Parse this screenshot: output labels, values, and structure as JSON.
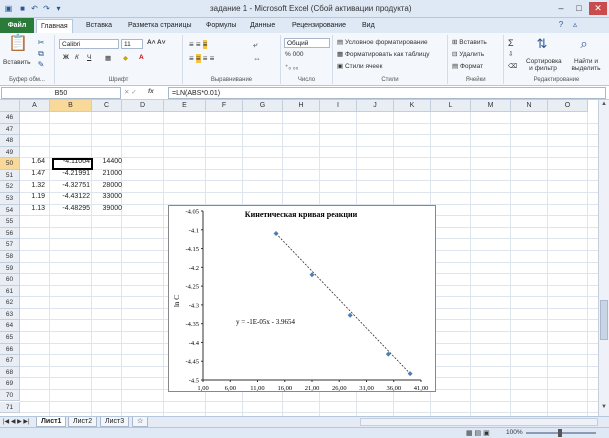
{
  "window": {
    "title": "задание 1 - Microsoft Excel (Сбой активации продукта)"
  },
  "tabs": {
    "file": "Файл",
    "items": [
      "Главная",
      "Вставка",
      "Разметка страницы",
      "Формулы",
      "Данные",
      "Рецензирование",
      "Вид"
    ]
  },
  "ribbon": {
    "clipboard": {
      "label": "Буфер обм...",
      "paste": "Вставить"
    },
    "font": {
      "label": "Шрифт",
      "name": "Calibri",
      "size": "11"
    },
    "alignment": {
      "label": "Выравнивание"
    },
    "number": {
      "label": "Число",
      "format": "Общий",
      "percent": "% 000"
    },
    "styles": {
      "label": "Стили",
      "conditional": "Условное форматирование",
      "table": "Форматировать как таблицу",
      "cell_styles": "Стили ячеек"
    },
    "cells": {
      "label": "Ячейки",
      "insert": "Вставить",
      "delete": "Удалить",
      "format": "Формат"
    },
    "editing": {
      "label": "Редактирование",
      "sort": "Сортировка и фильтр",
      "find": "Найти и выделить"
    }
  },
  "formula_bar": {
    "name_box": "B50",
    "fx": "fx",
    "formula": "=LN(ABS*0.01)"
  },
  "columns": [
    "A",
    "B",
    "C",
    "D",
    "E",
    "F",
    "G",
    "H",
    "I",
    "J",
    "K",
    "L",
    "M",
    "N",
    "O"
  ],
  "rows": [
    "46",
    "47",
    "48",
    "49",
    "50",
    "51",
    "52",
    "53",
    "54",
    "55",
    "56",
    "57",
    "58",
    "59",
    "60",
    "61",
    "62",
    "63",
    "64",
    "65",
    "66",
    "67",
    "68",
    "69",
    "70",
    "71"
  ],
  "cells": {
    "r50": {
      "a": "1.64",
      "b": "-4.11004",
      "c": "14400"
    },
    "r51": {
      "a": "1.47",
      "b": "-4.21991",
      "c": "21000"
    },
    "r52": {
      "a": "1.32",
      "b": "-4.32751",
      "c": "28000"
    },
    "r53": {
      "a": "1.19",
      "b": "-4.43122",
      "c": "33000"
    },
    "r54": {
      "a": "1.13",
      "b": "-4.48295",
      "c": "39000"
    }
  },
  "chart_data": {
    "type": "scatter",
    "title": "Кинетическая кривая реакции",
    "xlabel": "",
    "ylabel": "ln C",
    "x_ticks": [
      "1,00",
      "6,00",
      "11,00",
      "16,00",
      "21,00",
      "26,00",
      "31,00",
      "36,00",
      "41,00"
    ],
    "y_ticks": [
      "-4.05",
      "-4.1",
      "-4.15",
      "-4.2",
      "-4.25",
      "-4.3",
      "-4.35",
      "-4.4",
      "-4.45",
      "-4.5"
    ],
    "xlim": [
      1,
      41
    ],
    "ylim": [
      -4.5,
      -4.05
    ],
    "x": [
      14.4,
      21,
      28,
      35,
      39
    ],
    "y": [
      -4.11004,
      -4.21991,
      -4.32751,
      -4.43122,
      -4.48295
    ],
    "trendline_label": "y = -1E-05x - 3.9654",
    "trendline": true,
    "marker_color": "#4a7ebb"
  },
  "sheets": [
    "Лист1",
    "Лист2",
    "Лист3"
  ],
  "status": {
    "zoom": "100%"
  }
}
